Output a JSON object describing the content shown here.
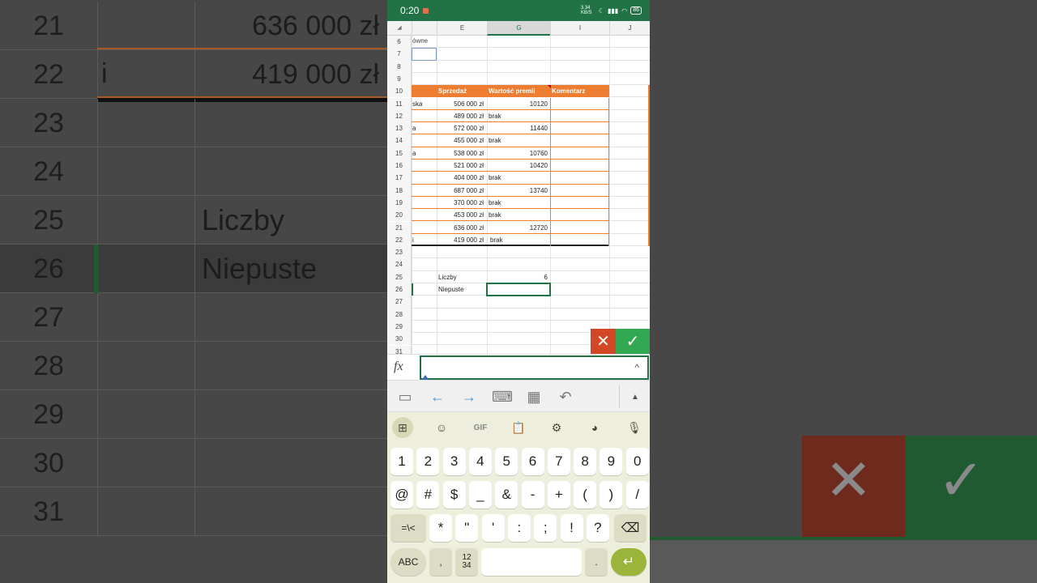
{
  "background": {
    "rows": [
      {
        "num": "21",
        "money": "636 000 zł",
        "text": ""
      },
      {
        "num": "22",
        "money": "419 000 zł",
        "text": "",
        "prefix": "i"
      },
      {
        "num": "23",
        "money": "",
        "text": ""
      },
      {
        "num": "24",
        "money": "",
        "text": ""
      },
      {
        "num": "25",
        "money": "",
        "text": "Liczby"
      },
      {
        "num": "26",
        "money": "",
        "text": "Niepuste"
      },
      {
        "num": "27",
        "money": "",
        "text": ""
      },
      {
        "num": "28",
        "money": "",
        "text": ""
      },
      {
        "num": "29",
        "money": "",
        "text": ""
      },
      {
        "num": "30",
        "money": "",
        "text": ""
      },
      {
        "num": "31",
        "money": "",
        "text": ""
      }
    ]
  },
  "status": {
    "time": "0:20",
    "battery": "86",
    "speed": "3.34 KB/S"
  },
  "sheet": {
    "columns": [
      "E",
      "G",
      "I",
      "J"
    ],
    "row_numbers": [
      "6",
      "7",
      "8",
      "9",
      "10",
      "11",
      "12",
      "13",
      "14",
      "15",
      "16",
      "17",
      "18",
      "19",
      "20",
      "21",
      "22",
      "23",
      "24",
      "25",
      "26",
      "27",
      "28",
      "29",
      "30",
      "31"
    ],
    "row6_text": "ówne",
    "headers": {
      "sales": "Sprzedaż",
      "bonus": "Wartość premii",
      "comment": "Komentarz"
    },
    "rows": [
      {
        "prefix": "ska",
        "sales": "506 000 zł",
        "bonus": "10120",
        "bonus_text": ""
      },
      {
        "prefix": "",
        "sales": "489 000 zł",
        "bonus": "",
        "bonus_text": "brak"
      },
      {
        "prefix": "a",
        "sales": "572 000 zł",
        "bonus": "11440",
        "bonus_text": ""
      },
      {
        "prefix": "",
        "sales": "455 000 zł",
        "bonus": "",
        "bonus_text": "brak"
      },
      {
        "prefix": "a",
        "sales": "538 000 zł",
        "bonus": "10760",
        "bonus_text": ""
      },
      {
        "prefix": "",
        "sales": "521 000 zł",
        "bonus": "10420",
        "bonus_text": ""
      },
      {
        "prefix": "",
        "sales": "404 000 zł",
        "bonus": "",
        "bonus_text": "brak"
      },
      {
        "prefix": "",
        "sales": "687 000 zł",
        "bonus": "13740",
        "bonus_text": ""
      },
      {
        "prefix": "",
        "sales": "370 000 zł",
        "bonus": "",
        "bonus_text": "brak"
      },
      {
        "prefix": "",
        "sales": "453 000 zł",
        "bonus": "",
        "bonus_text": "brak"
      },
      {
        "prefix": "",
        "sales": "636 000 zł",
        "bonus": "12720",
        "bonus_text": ""
      },
      {
        "prefix": "i",
        "sales": "419 000 zł",
        "bonus": "",
        "bonus_text": "brak"
      }
    ],
    "summary": [
      {
        "label": "Liczby",
        "value": "6"
      },
      {
        "label": "Niepuste",
        "value": ""
      }
    ]
  },
  "formula_bar": {
    "label": "fx",
    "value": "",
    "caret": "^"
  },
  "keyboard": {
    "top_icons": [
      "grid-icon",
      "sticker-icon",
      "GIF",
      "clipboard-icon",
      "settings-icon",
      "palette-icon",
      "mic-icon"
    ],
    "gif_label": "GIF",
    "row1": [
      "1",
      "2",
      "3",
      "4",
      "5",
      "6",
      "7",
      "8",
      "9",
      "0"
    ],
    "row2": [
      "@",
      "#",
      "$",
      "_",
      "&",
      "-",
      "+",
      "(",
      ")",
      "/"
    ],
    "row3": [
      "=\\<",
      "*",
      "\"",
      "'",
      ":",
      ";",
      "!",
      "?"
    ],
    "abc": "ABC",
    "comma": ",",
    "numpad_top": "12",
    "numpad_bottom": "34",
    "period": "."
  },
  "colors": {
    "excel_green": "#217346",
    "orange": "#ed7d31",
    "cancel_red": "#d24726",
    "confirm_green": "#33a852"
  }
}
